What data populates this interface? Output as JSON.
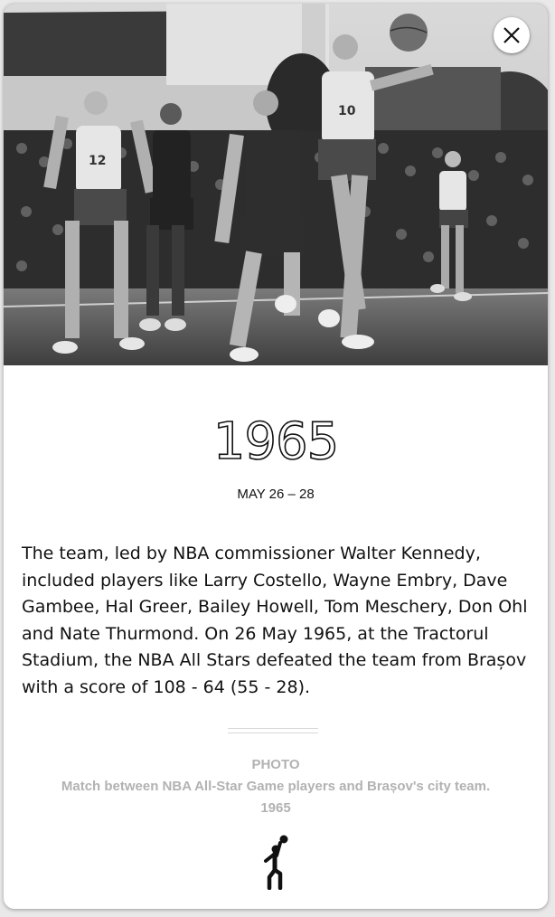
{
  "close_button": {
    "icon": "close-icon"
  },
  "photo": {
    "description_icon": "basketball-photo"
  },
  "event": {
    "year": "1965",
    "date": "MAY 26 – 28",
    "description": "The team, led by NBA commissioner Walter Kennedy, included players like Larry Costello, Wayne Embry, Dave Gambee, Hal Greer, Bailey Howell, Tom Meschery, Don Ohl and Nate Thurmond. On 26 May 1965, at the Tractorul Stadium, the NBA All Stars defeated the team from Brașov with a score of 108 - 64 (55 - 28)."
  },
  "caption": {
    "label": "PHOTO",
    "text": "Match between NBA All-Star Game players and Brașov's city team.",
    "year": "1965"
  },
  "footer_icon": "basketball-player-icon"
}
